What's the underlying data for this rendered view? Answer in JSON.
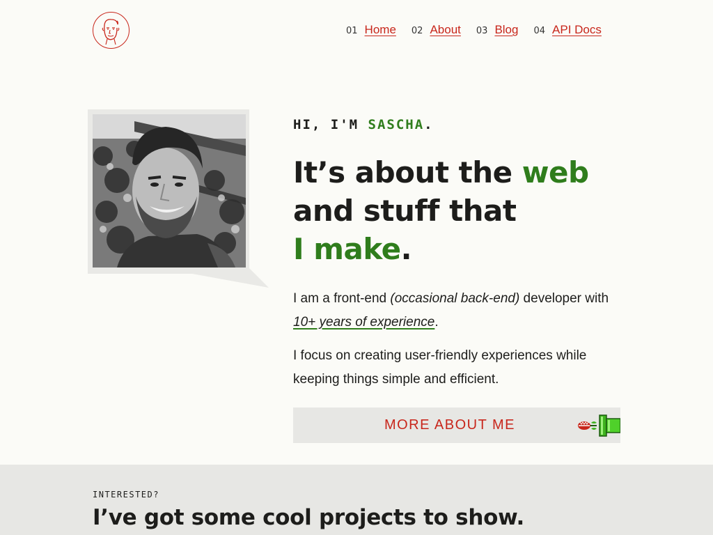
{
  "header": {
    "logo_icon": "face-line-drawing-icon",
    "nav": [
      {
        "number": "01",
        "label": "Home"
      },
      {
        "number": "02",
        "label": "About"
      },
      {
        "number": "03",
        "label": "Blog"
      },
      {
        "number": "04",
        "label": "API Docs"
      }
    ]
  },
  "intro": {
    "greeting_prefix": "HI, I'M ",
    "greeting_name": "SASCHA",
    "greeting_suffix": ".",
    "headline": {
      "part1": "It’s about the ",
      "part1_accent": "web",
      "part2": "and stuff that",
      "part3_accent": "I make",
      "part3_end": "."
    },
    "bio1": {
      "a": "I am a front-end ",
      "em": "(occasional back-end)",
      "b": " developer with ",
      "link": "10+ years of experience",
      "c": "."
    },
    "bio2": "I focus on creating user-friendly experiences while keeping things simple and efficient.",
    "cta_label": "MORE ABOUT ME",
    "cta_icon": "piranha-plant-pipe-icon",
    "portrait_icon": "portrait-photo"
  },
  "projects": {
    "eyebrow": "INTERESTED?",
    "title": "I’ve got some cool projects to show."
  },
  "colors": {
    "accent_red": "#c8261b",
    "accent_green": "#2f7d1c",
    "background": "#fbfbf7",
    "panel": "#e7e7e4"
  }
}
